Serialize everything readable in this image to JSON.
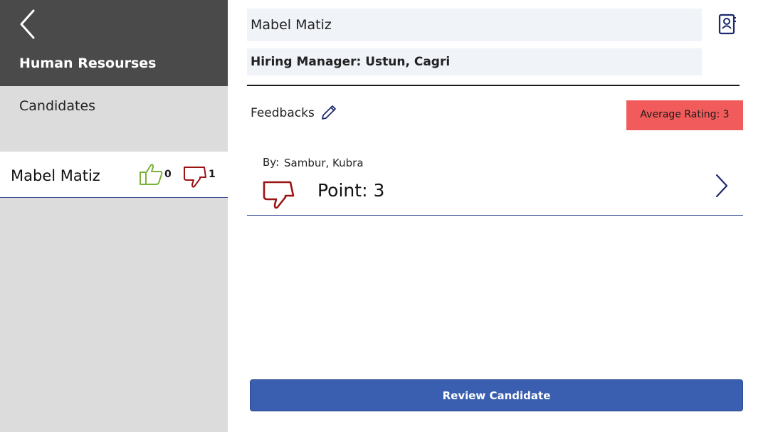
{
  "sidebar": {
    "app_title": "Human Resourses",
    "section_label": "Candidates",
    "candidates": [
      {
        "name": "Mabel Matiz",
        "thumbs_up": "0",
        "thumbs_down": "1"
      }
    ]
  },
  "main": {
    "candidate_name": "Mabel Matiz",
    "hiring_manager": "Hiring Manager: Ustun, Cagri",
    "feedbacks_label": "Feedbacks",
    "average_rating": "Average Rating: 3",
    "feedback_items": [
      {
        "by_label": "By:",
        "by_value": "Sambur, Kubra",
        "point": "Point: 3"
      }
    ],
    "review_button": "Review Candidate"
  },
  "icons": {
    "back": "chevron-left-icon",
    "thumb_up": "thumbs-up-icon",
    "thumb_down": "thumbs-down-icon",
    "contact": "contact-card-icon",
    "edit": "pencil-icon",
    "chevron": "chevron-right-icon"
  },
  "colors": {
    "header": "#4a4a4a",
    "sidebar": "#dcdcdc",
    "accent": "#3a5fb0",
    "rating_badge": "#f15b5b",
    "thumb_up": "#7ab23a",
    "thumb_down": "#9b1414",
    "navy": "#1e2a6e"
  }
}
